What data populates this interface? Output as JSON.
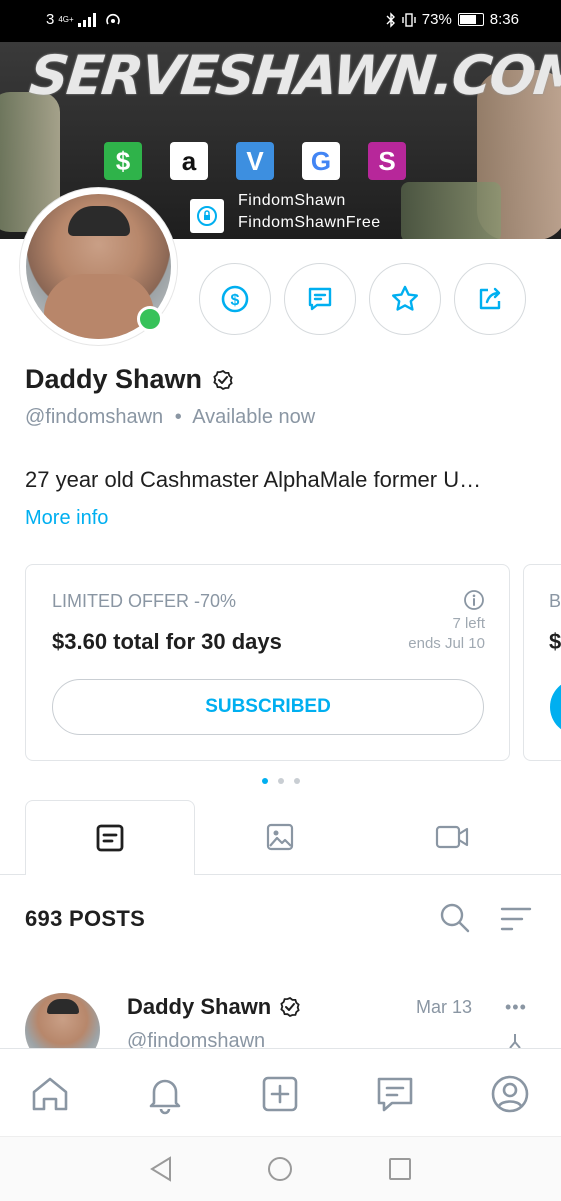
{
  "status_bar": {
    "signal": "3",
    "network": "4G+",
    "battery": "73%",
    "time": "8:36"
  },
  "banner": {
    "title": "SERVESHAWN.COM",
    "payment_icons": [
      {
        "label": "$",
        "color": "#2fb34a",
        "name": "cashapp-icon"
      },
      {
        "label": "a",
        "color": "#ffffff",
        "name": "amazon-icon"
      },
      {
        "label": "V",
        "color": "#3d8fe0",
        "name": "venmo-icon"
      },
      {
        "label": "G",
        "color": "#ffffff",
        "name": "google-icon"
      },
      {
        "label": "S",
        "color": "#b7279a",
        "name": "stripe-icon"
      }
    ],
    "line1": "FindomShawn",
    "line2": "FindomShawnFree"
  },
  "profile": {
    "name": "Daddy Shawn",
    "handle": "@findomshawn",
    "separator": "•",
    "availability": "Available now",
    "bio": "27 year old Cashmaster AlphaMale former U…",
    "more_info": "More info"
  },
  "offer": {
    "title": "LIMITED OFFER -70%",
    "price": "$3.60 total for 30 days",
    "left": "7 left",
    "ends": "ends Jul 10",
    "button": "SUBSCRIBED"
  },
  "offer2": {
    "title_peek": "B",
    "price_peek": "$"
  },
  "posts": {
    "count_label": "693 POSTS"
  },
  "post": {
    "author": "Daddy Shawn",
    "handle": "@findomshawn",
    "date": "Mar 13",
    "more": "•••"
  },
  "colors": {
    "accent": "#00aff0",
    "online": "#37c25a",
    "muted": "#8a96a3"
  }
}
